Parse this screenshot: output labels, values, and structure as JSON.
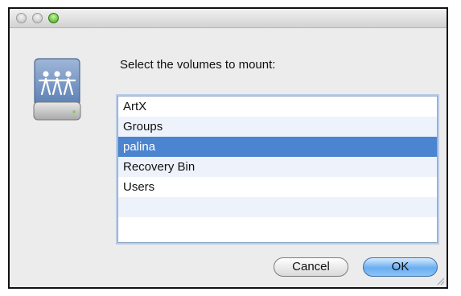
{
  "dialog": {
    "prompt": "Select the volumes to mount:",
    "volumes": [
      {
        "label": "ArtX"
      },
      {
        "label": "Groups"
      },
      {
        "label": "palina",
        "selected": true
      },
      {
        "label": "Recovery Bin"
      },
      {
        "label": "Users"
      }
    ],
    "buttons": {
      "cancel_label": "Cancel",
      "ok_label": "OK"
    }
  },
  "colors": {
    "selection": "#4b84cf",
    "alt_row": "#eef3fb",
    "window_bg": "#ececec"
  },
  "icons": {
    "server": "shared-server-drive-icon",
    "close": "close-icon",
    "minimize": "minimize-icon",
    "zoom": "zoom-icon",
    "resize": "resize-grip-icon"
  }
}
